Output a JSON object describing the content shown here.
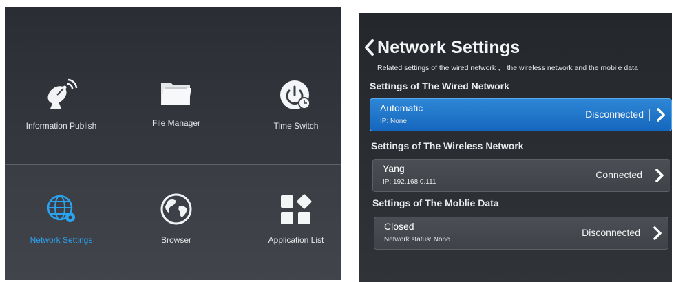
{
  "launcher": {
    "tiles": [
      {
        "label": "Information Publish",
        "icon": "satellite-dish-icon"
      },
      {
        "label": "File Manager",
        "icon": "folder-icon"
      },
      {
        "label": "Time Switch",
        "icon": "power-clock-icon"
      },
      {
        "label": "Network Settings",
        "icon": "globe-gear-icon",
        "active": true
      },
      {
        "label": "Browser",
        "icon": "globe-icon"
      },
      {
        "label": "Application List",
        "icon": "app-grid-icon"
      }
    ],
    "active_color": "#2aa3f0"
  },
  "network_settings": {
    "title": "Network Settings",
    "subtitle": "Related settings of the wired network 、 the wireless network and the mobile data",
    "wired": {
      "section_title": "Settings of The Wired Network",
      "name": "Automatic",
      "detail": "IP: None",
      "status": "Disconnected"
    },
    "wireless": {
      "section_title": "Settings of The Wireless Network",
      "name": "Yang",
      "detail": "IP: 192.168.0.111",
      "status": "Connected"
    },
    "mobile": {
      "section_title": "Settings of The Moblie Data",
      "name": "Closed",
      "detail": "Network status: None",
      "status": "Disconnected"
    },
    "selected_color": "#1f78cc"
  }
}
